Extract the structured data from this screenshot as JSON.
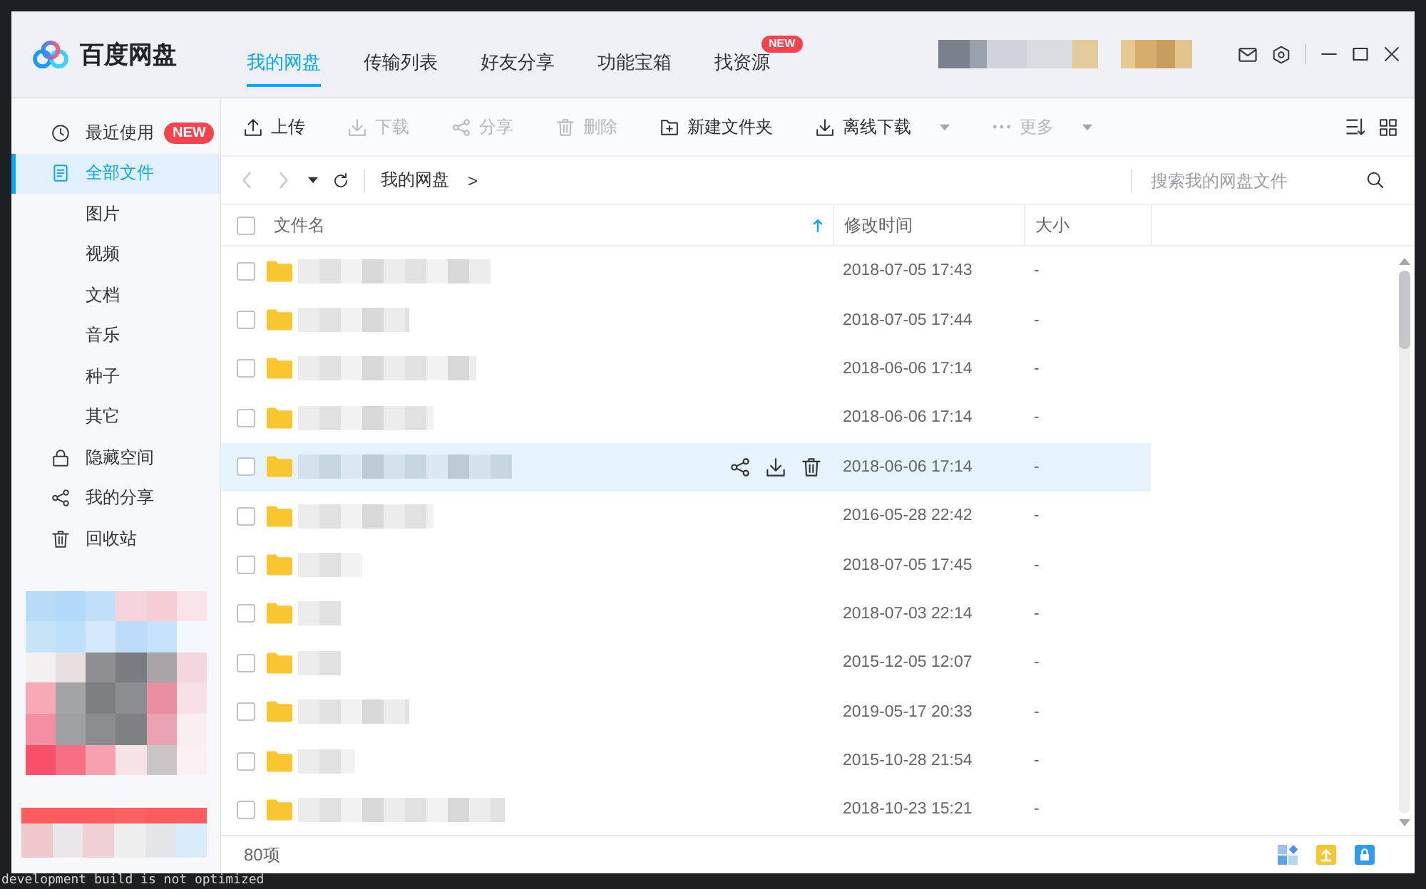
{
  "window": {
    "app_name": "百度网盘",
    "tabs": [
      {
        "label": "我的网盘",
        "selected": true
      },
      {
        "label": "传输列表",
        "selected": false
      },
      {
        "label": "好友分享",
        "selected": false
      },
      {
        "label": "功能宝箱",
        "selected": false
      },
      {
        "label": "找资源",
        "selected": false,
        "badge": "NEW"
      }
    ]
  },
  "sidebar": {
    "items": [
      {
        "label": "最近使用",
        "selected": false,
        "badge": "NEW"
      },
      {
        "label": "全部文件",
        "selected": true,
        "children": [
          {
            "label": "图片",
            "selected": false
          },
          {
            "label": "视频",
            "selected": false
          },
          {
            "label": "文档",
            "selected": false
          },
          {
            "label": "音乐",
            "selected": false
          },
          {
            "label": "种子",
            "selected": false
          },
          {
            "label": "其它",
            "selected": false
          }
        ]
      },
      {
        "label": "隐藏空间",
        "selected": false
      },
      {
        "label": "我的分享",
        "selected": false
      },
      {
        "label": "回收站",
        "selected": false
      }
    ]
  },
  "toolbar": {
    "buttons": [
      {
        "label": "上传",
        "disabled": false,
        "dropdown": false
      },
      {
        "label": "下载",
        "disabled": true,
        "dropdown": false
      },
      {
        "label": "分享",
        "disabled": true,
        "dropdown": false
      },
      {
        "label": "删除",
        "disabled": true,
        "dropdown": false
      },
      {
        "label": "新建文件夹",
        "disabled": false,
        "dropdown": false
      },
      {
        "label": "离线下载",
        "disabled": false,
        "dropdown": true
      },
      {
        "label": "更多",
        "disabled": true,
        "dropdown": true
      }
    ]
  },
  "navigation": {
    "back": {
      "disabled": true
    },
    "forward": {
      "disabled": true
    },
    "breadcrumb": [
      "我的网盘"
    ],
    "separator": ">",
    "search": {
      "placeholder": "搜索我的网盘文件"
    }
  },
  "table": {
    "select_all": {
      "checked": false
    },
    "columns": [
      {
        "label": "文件名",
        "sorted": true
      },
      {
        "label": "修改时间",
        "sorted": false
      },
      {
        "label": "大小",
        "sorted": false
      }
    ],
    "rows": [
      {
        "modified": "2018-07-05 17:43",
        "size": "-",
        "checked": false,
        "hovered": false
      },
      {
        "modified": "2018-07-05 17:44",
        "size": "-",
        "checked": false,
        "hovered": false
      },
      {
        "modified": "2018-06-06 17:14",
        "size": "-",
        "checked": false,
        "hovered": false
      },
      {
        "modified": "2018-06-06 17:14",
        "size": "-",
        "checked": false,
        "hovered": false
      },
      {
        "modified": "2018-06-06 17:14",
        "size": "-",
        "checked": false,
        "hovered": true
      },
      {
        "modified": "2016-05-28 22:42",
        "size": "-",
        "checked": false,
        "hovered": false
      },
      {
        "modified": "2018-07-05 17:45",
        "size": "-",
        "checked": false,
        "hovered": false
      },
      {
        "modified": "2018-07-03 22:14",
        "size": "-",
        "checked": false,
        "hovered": false
      },
      {
        "modified": "2015-12-05 12:07",
        "size": "-",
        "checked": false,
        "hovered": false
      },
      {
        "modified": "2019-05-17 20:33",
        "size": "-",
        "checked": false,
        "hovered": false
      },
      {
        "modified": "2015-10-28 21:54",
        "size": "-",
        "checked": false,
        "hovered": false
      },
      {
        "modified": "2018-10-23 15:21",
        "size": "-",
        "checked": false,
        "hovered": false
      }
    ]
  },
  "status_bar": {
    "item_count": "80项"
  },
  "terminal": {
    "text": "development build is not optimized"
  }
}
